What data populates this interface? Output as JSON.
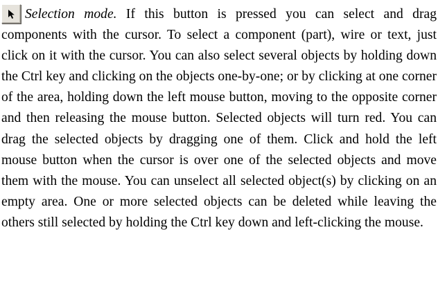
{
  "selection_button": {
    "icon": "arrow-cursor-icon",
    "colors": {
      "button_face": "#e6e3dc",
      "icon": "#000000"
    }
  },
  "paragraph": {
    "mode_name": "Selection mode.",
    "body": " If this button is pressed you can select and drag components with the cursor. To select a component (part), wire or text, just click on it with the cursor. You can also select several objects by holding down the Ctrl key and clicking on the objects one-by-one; or by clicking at one corner of the area, holding down the left mouse button, moving to the opposite corner and then releasing the mouse button. Selected objects will turn red. You can drag the selected objects by dragging one of them. Click and hold the left mouse button when the cursor is over one of the selected objects and move them with the mouse. You can unselect all selected object(s) by clicking on an empty area. One or more selected objects can be deleted while leaving the others still selected by holding the Ctrl key down and left-clicking the mouse."
  }
}
